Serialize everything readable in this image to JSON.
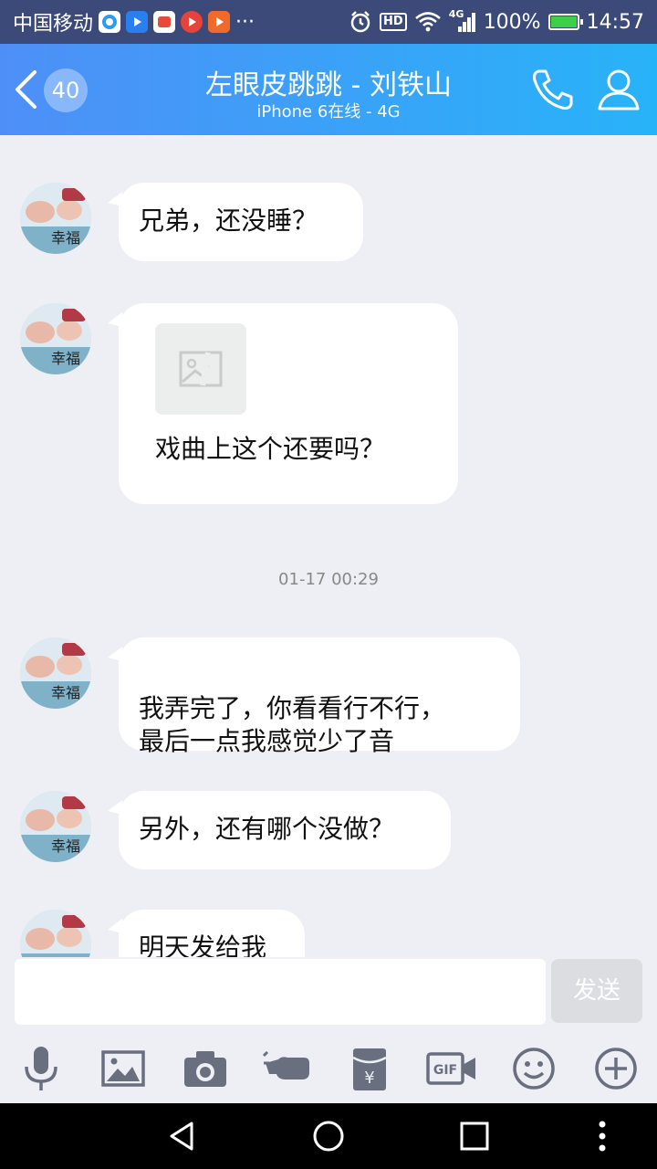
{
  "status_bar": {
    "carrier": "中国移动",
    "more": "···",
    "hd": "HD",
    "network": "4G",
    "battery": "100%",
    "time": "14:57"
  },
  "header": {
    "unread_count": "40",
    "title": "左眼皮跳跳 - 刘铁山",
    "subtitle": "iPhone 6在线 - 4G"
  },
  "messages": [
    {
      "text": "兄弟，还没睡？"
    },
    {
      "text": "戏曲上这个还要吗？"
    },
    {
      "text": "我弄完了，你看看行不行，\n最后一点我感觉少了音"
    },
    {
      "text": "另外，还有哪个没做？"
    },
    {
      "text": "明天发给我"
    }
  ],
  "timestamp": "01-17 00:29",
  "avatar_caption": "幸福",
  "input": {
    "placeholder": "",
    "send_label": "发送"
  },
  "toolbar": [
    "voice",
    "image",
    "camera",
    "poke",
    "red-packet",
    "gif",
    "emoji",
    "more"
  ],
  "colors": {
    "header_gradient_start": "#4e8ff7",
    "header_gradient_end": "#28b3f8",
    "chat_background": "#eeeff4",
    "icon_gray": "#6a6f80"
  }
}
